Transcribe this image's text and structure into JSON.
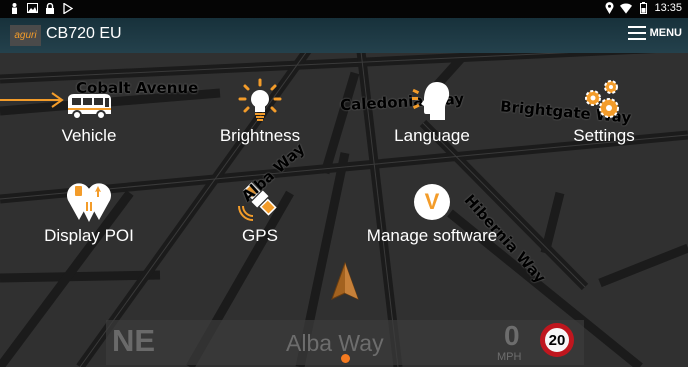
{
  "status_bar": {
    "left_icons": [
      "person-icon",
      "image-icon",
      "lock-icon",
      "play-store-icon"
    ],
    "right_icons": [
      "location-icon",
      "wifi-icon",
      "battery-icon"
    ],
    "time": "13:35"
  },
  "header": {
    "logo_text": "aguri",
    "title": "CB720 EU",
    "menu_label": "MENU"
  },
  "map": {
    "streets": [
      "Cobalt Avenue",
      "Caledonia Way",
      "Brightgate Way",
      "Hibernia Way",
      "Alba Way"
    ]
  },
  "tiles": [
    {
      "id": "vehicle",
      "label": "Vehicle",
      "icon": "bus-icon"
    },
    {
      "id": "brightness",
      "label": "Brightness",
      "icon": "lightbulb-icon"
    },
    {
      "id": "language",
      "label": "Language",
      "icon": "speaking-head-icon"
    },
    {
      "id": "settings",
      "label": "Settings",
      "icon": "gears-icon"
    },
    {
      "id": "display_poi",
      "label": "Display POI",
      "icon": "poi-pins-icon"
    },
    {
      "id": "gps",
      "label": "GPS",
      "icon": "satellite-icon"
    },
    {
      "id": "manage_software",
      "label": "Manage software",
      "icon": "software-v-icon",
      "icon_text": "V"
    }
  ],
  "nav_bar": {
    "heading": "NE",
    "road": "Alba Way",
    "speed": "0",
    "speed_unit": "MPH",
    "speed_limit": "20"
  },
  "colors": {
    "accent": "#f39c2a",
    "header_bg": "#1f3a45",
    "map_bg": "#2f2f2f",
    "road_line": "#1d1d1d",
    "speed_limit_ring": "#c0161e"
  }
}
